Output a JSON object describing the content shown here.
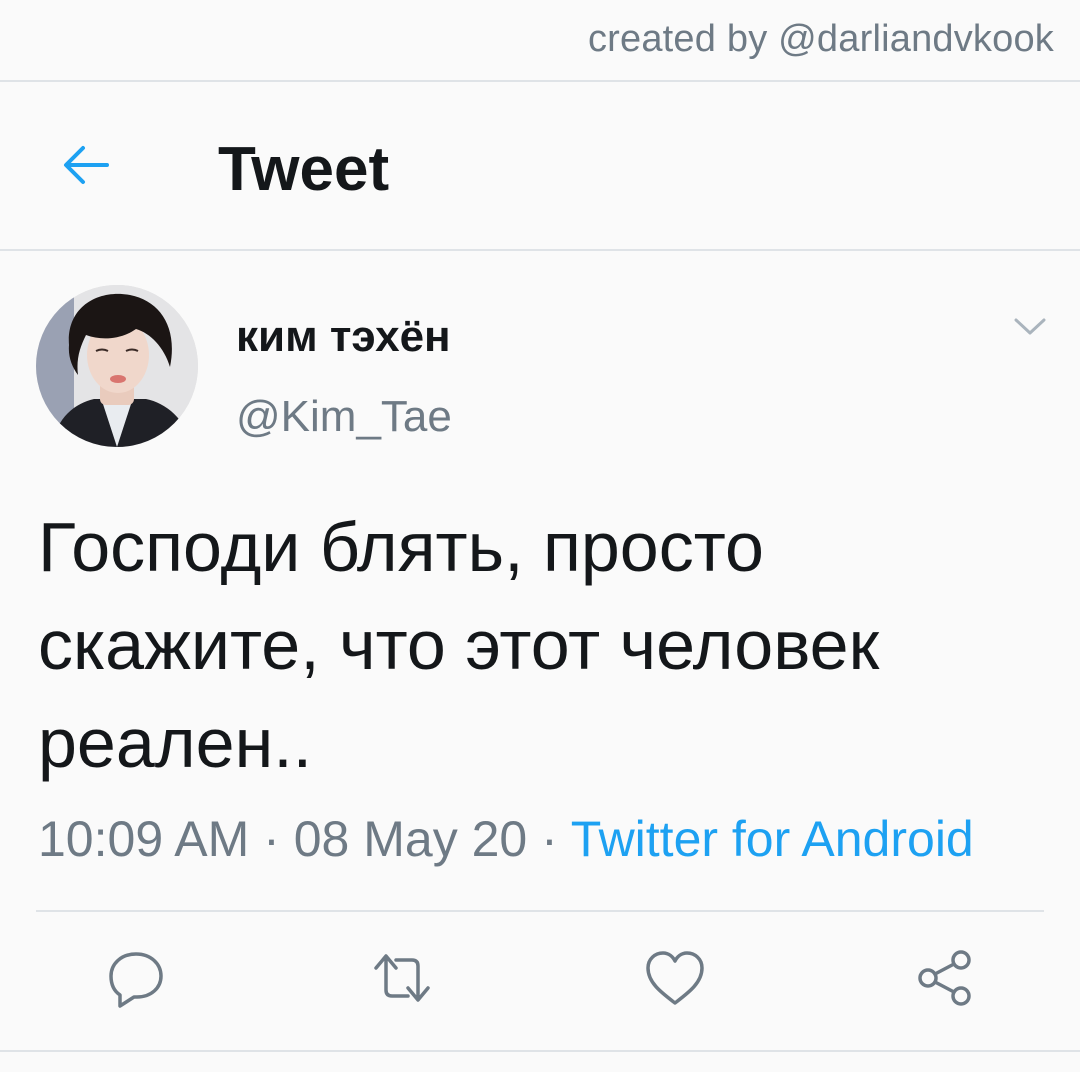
{
  "credit": "created by @darliandvkook",
  "header": {
    "title": "Tweet",
    "back_icon": "arrow-left-icon",
    "accent": "#1da1f2"
  },
  "tweet": {
    "display_name": "ким тэхён",
    "handle": "@Kim_Tae",
    "text": "Господи блять, просто скажите, что этот человек реален..",
    "time": "10:09 AM",
    "date": "08 May 20",
    "separator": "·",
    "source": "Twitter for Android",
    "source_color": "#1da1f2"
  },
  "actions": [
    "reply-icon",
    "retweet-icon",
    "like-icon",
    "share-icon"
  ],
  "colors": {
    "text": "#14171a",
    "secondary": "#6e7a85",
    "divider": "#dfe3e7",
    "background": "#fafafa"
  }
}
